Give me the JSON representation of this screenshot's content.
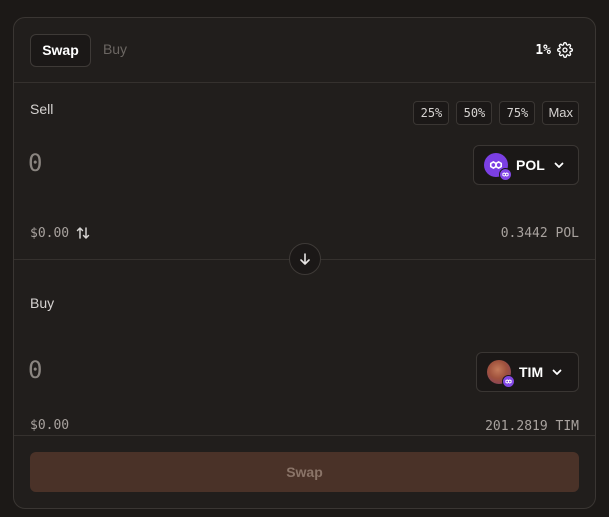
{
  "header": {
    "tabs": [
      {
        "label": "Swap",
        "active": true
      },
      {
        "label": "Buy",
        "active": false
      }
    ],
    "slippage": "1%",
    "settings_icon": "gear-icon"
  },
  "sell": {
    "label": "Sell",
    "percent_buttons": [
      "25%",
      "50%",
      "75%",
      "Max"
    ],
    "amount_placeholder": "0",
    "token": {
      "symbol": "POL",
      "color": "#7b3fe4"
    },
    "usd_value": "$0.00",
    "balance": "0.3442 POL"
  },
  "buy": {
    "label": "Buy",
    "amount_placeholder": "0",
    "token": {
      "symbol": "TIM"
    },
    "usd_value": "$0.00",
    "balance": "201.2819 TIM"
  },
  "swap_button": {
    "label": "Swap",
    "color": "#4a3228"
  },
  "colors": {
    "background": "#1c1917",
    "card": "#211e1c",
    "chain_badge": "#8247e5"
  }
}
